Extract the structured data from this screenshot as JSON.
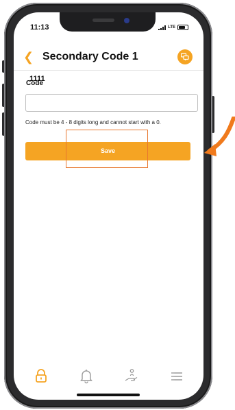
{
  "status": {
    "time": "11:13",
    "network": "LTE"
  },
  "header": {
    "back_icon": "chevron-left-icon",
    "title": "Secondary Code 1",
    "chat_icon": "chat-bubbles-icon"
  },
  "form": {
    "overlay_value": "1111",
    "label": "Code",
    "input_value": "",
    "helper": "Code must be 4 - 8 digits long and cannot start with a 0.",
    "save_label": "Save"
  },
  "tabs": [
    {
      "name": "lock",
      "icon": "lock-icon",
      "active": true
    },
    {
      "name": "notifications",
      "icon": "bell-icon",
      "active": false
    },
    {
      "name": "service",
      "icon": "hand-person-icon",
      "active": false
    },
    {
      "name": "menu",
      "icon": "hamburger-menu-icon",
      "active": false
    }
  ],
  "colors": {
    "accent": "#f5a423",
    "annotation": "#e8772e",
    "tab_inactive": "#9a9a9a"
  }
}
